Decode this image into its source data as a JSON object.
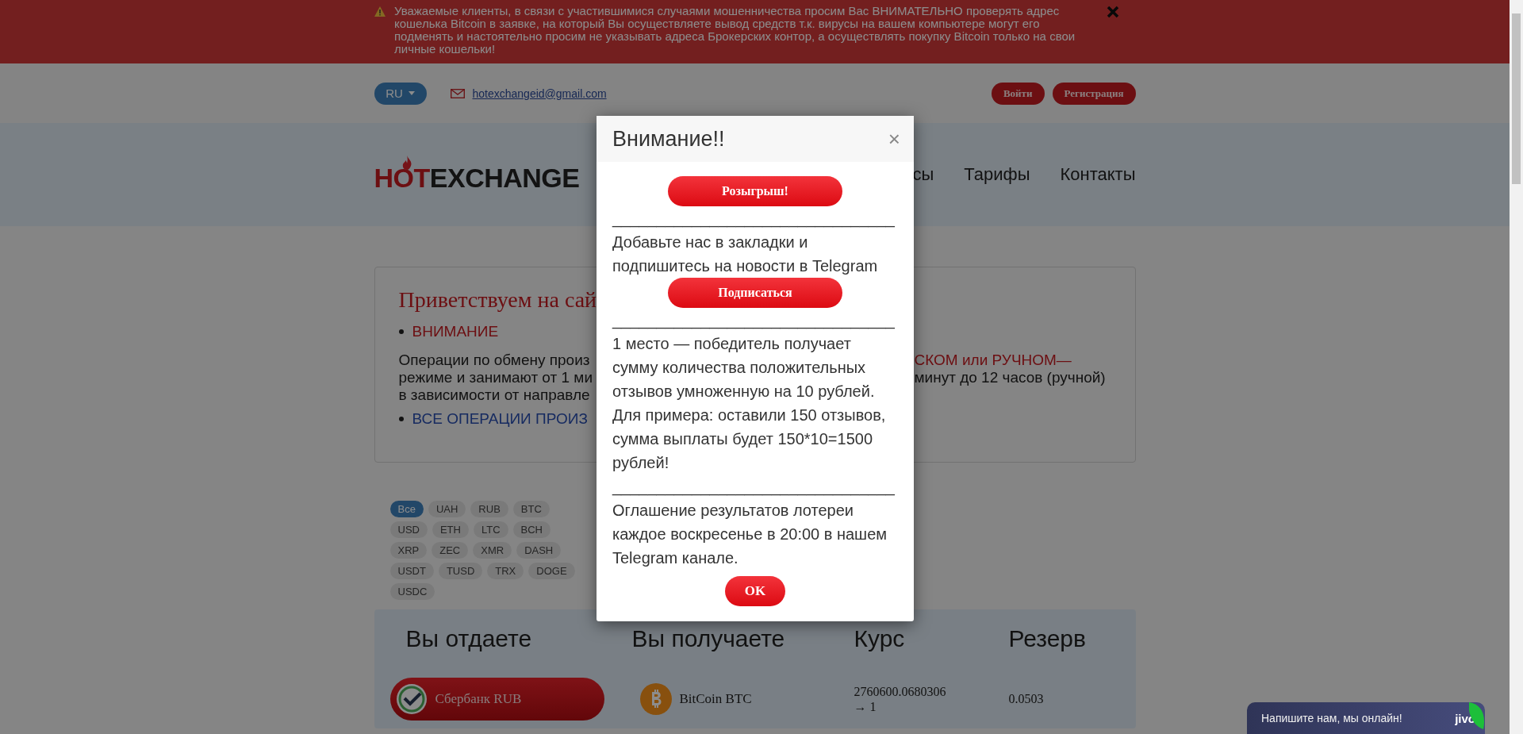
{
  "alert_banner": {
    "text": "Уважаемые клиенты, в связи с участившимися случаями мошенничества просим Вас ВНИМАТЕЛЬНО проверять адрес кошелька Bitcoin в заявке, на который Вы осуществляете вывод средств т.к. вирусы на вашем компьютере могут его подменять и настоятельно просим не указывать адреса Брокерских контор, а осуществлять покупку Bitcoin только на свои личные кошельки!"
  },
  "topbar": {
    "language": "RU",
    "email": "hotexchangeid@gmail.com",
    "buttons": [
      "Войти",
      "Регистрация"
    ]
  },
  "header": {
    "logo_hot": "HOT",
    "logo_rest": "EXCHANGE",
    "nav": [
      "сы",
      "Тарифы",
      "Контакты"
    ]
  },
  "welcome": {
    "title": "Приветствуем на сай",
    "blocks": [
      {
        "kind": "warning",
        "left": "ВНИМАНИЕ"
      },
      {
        "kind": "line",
        "left": "Операции по обмену произ",
        "right": "СКОМ или РУЧНОМ—",
        "right_highlighted": true
      },
      {
        "kind": "line",
        "left": "режиме и занимают от 1 ми",
        "right": "минут до 12 часов (ручной)",
        "right_highlighted": false
      },
      {
        "kind": "line",
        "left": "в зависимости от направле"
      },
      {
        "kind": "link",
        "left": "ВСЕ ОПЕРАЦИИ ПРОИЗ"
      }
    ]
  },
  "filter_rows": [
    [
      {
        "label": "Все",
        "selected": true
      },
      {
        "label": "UAH",
        "selected": false
      },
      {
        "label": "RUB",
        "selected": false
      },
      {
        "label": "BTC",
        "selected": false
      }
    ],
    [
      {
        "label": "USD",
        "selected": false
      },
      {
        "label": "ETH",
        "selected": false
      },
      {
        "label": "LTC",
        "selected": false
      },
      {
        "label": "BCH",
        "selected": false
      }
    ],
    [
      {
        "label": "XRP",
        "selected": false
      },
      {
        "label": "ZEC",
        "selected": false
      },
      {
        "label": "XMR",
        "selected": false
      },
      {
        "label": "DASH",
        "selected": false
      }
    ],
    [
      {
        "label": "USDT",
        "selected": false
      },
      {
        "label": "TUSD",
        "selected": false
      },
      {
        "label": "TRX",
        "selected": false
      },
      {
        "label": "DOGE",
        "selected": false
      }
    ],
    [
      {
        "label": "USDC",
        "selected": false
      }
    ]
  ],
  "table": {
    "columns": [
      "Вы отдаете",
      "Вы получаете",
      "Курс",
      "Резерв"
    ],
    "rows": [
      {
        "give": "Сбербанк RUB",
        "selected": true,
        "get": "BitCoin BTC",
        "rate": [
          "2760600.0680306",
          "→ 1"
        ],
        "reserve": "0.0503"
      }
    ]
  },
  "modal": {
    "title": "Внимание!!",
    "close": "×",
    "blocks": [
      {
        "kind": "button",
        "text": "Розыгрыш!"
      },
      {
        "kind": "rule",
        "text": "________________________________"
      },
      {
        "kind": "text",
        "text": "Добавьте нас в закладки и подпишитесь на новости в Telegram"
      },
      {
        "kind": "button",
        "text": "Подписаться"
      },
      {
        "kind": "rule",
        "text": "________________________________"
      },
      {
        "kind": "text",
        "text": "1 место — победитель получает сумму количества положительных отзывов умноженную на 10 рублей. Для примера: оставили 150 отзывов, сумма выплаты будет 150*10=1500 рублей!"
      },
      {
        "kind": "rule",
        "text": "________________________________"
      },
      {
        "kind": "text",
        "text": "Оглашение результатов лотереи каждое воскресенье в 20:00 в нашем Telegram канале."
      }
    ],
    "ok": "OK"
  },
  "chat": {
    "text": "Напишите нам, мы онлайн!",
    "brand": "jivo"
  }
}
